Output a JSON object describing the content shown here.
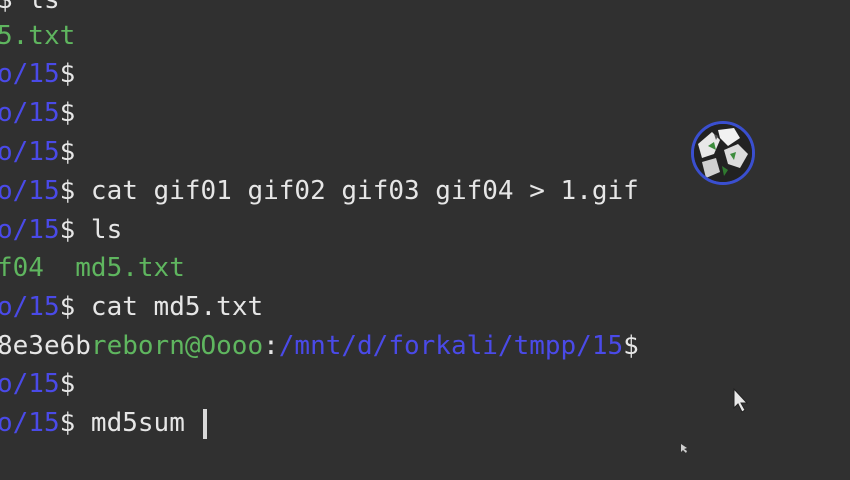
{
  "terminal": {
    "lines": [
      {
        "id": "l0",
        "path": "",
        "prompt": "$",
        "command": "ls",
        "output": ""
      },
      {
        "id": "l1",
        "output": "5.txt"
      },
      {
        "id": "l2",
        "path": "o/15",
        "prompt": "$",
        "command": ""
      },
      {
        "id": "l3",
        "path": "o/15",
        "prompt": "$",
        "command": ""
      },
      {
        "id": "l4",
        "path": "o/15",
        "prompt": "$",
        "command": ""
      },
      {
        "id": "l5",
        "path": "o/15",
        "prompt": "$",
        "command": " cat gif01 gif02 gif03 gif04 > 1.gif"
      },
      {
        "id": "l6",
        "path": "o/15",
        "prompt": "$",
        "command": " ls"
      },
      {
        "id": "l7",
        "output_a": "f04",
        "output_b": "  md5.txt"
      },
      {
        "id": "l8",
        "path": "o/15",
        "prompt": "$",
        "command": " cat md5.txt"
      },
      {
        "id": "l9",
        "hash": "8e3e6b",
        "user": "reborn@Oooo",
        "colon": ":",
        "path": "/mnt/d/forkali/tmpp/15",
        "prompt": "$"
      },
      {
        "id": "l10",
        "path": "o/15",
        "prompt": "$",
        "command": ""
      },
      {
        "id": "l11",
        "path": "o/15",
        "prompt": "$",
        "command": " md5sum "
      }
    ]
  },
  "colors": {
    "background": "#303030",
    "path": "#4a4ae8",
    "file": "#5fb65f",
    "text": "#e6e6e6"
  },
  "icons": {
    "avatar": "avatar-image-icon",
    "pointer": "mouse-pointer-icon"
  }
}
